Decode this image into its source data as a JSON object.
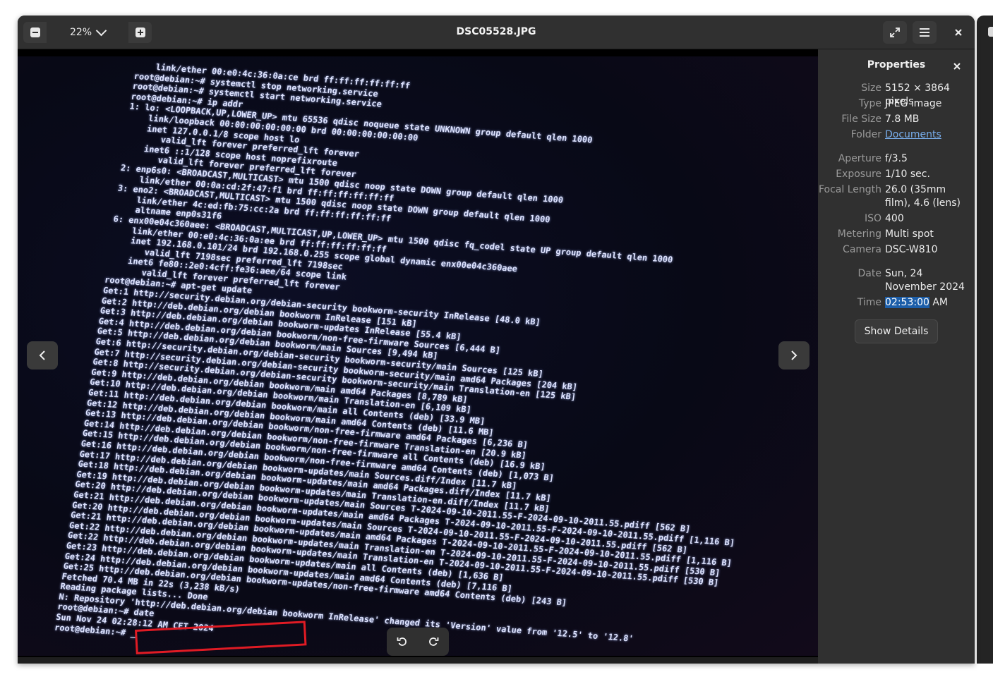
{
  "header": {
    "title": "DSC05528.JPG",
    "zoom": "22%"
  },
  "photo_text": {
    "lines": [
      "    link/ether 00:e0:4c:36:0a:ce brd ff:ff:ff:ff:ff:ff",
      "root@debian:~# systemctl stop networking.service",
      "root@debian:~# systemctl start networking.service",
      "root@debian:~# ip addr",
      "1: lo: <LOOPBACK,UP,LOWER_UP> mtu 65536 qdisc noqueue state UNKNOWN group default qlen 1000",
      "    link/loopback 00:00:00:00:00:00 brd 00:00:00:00:00:00",
      "    inet 127.0.0.1/8 scope host lo",
      "       valid_lft forever preferred_lft forever",
      "    inet6 ::1/128 scope host noprefixroute",
      "       valid_lft forever preferred_lft forever",
      "2: enp6s0: <BROADCAST,MULTICAST> mtu 1500 qdisc noop state DOWN group default qlen 1000",
      "    link/ether 00:0a:cd:2f:47:f1 brd ff:ff:ff:ff:ff:ff",
      "3: eno2: <BROADCAST,MULTICAST> mtu 1500 qdisc noop state DOWN group default qlen 1000",
      "    link/ether 4c:ed:fb:75:cc:2a brd ff:ff:ff:ff:ff:ff",
      "    altname enp0s31f6",
      "6: enx00e04c360aee: <BROADCAST,MULTICAST,UP,LOWER_UP> mtu 1500 qdisc fq_codel state UP group default qlen 1000",
      "    link/ether 00:e0:4c:36:0a:ee brd ff:ff:ff:ff:ff:ff",
      "    inet 192.168.0.101/24 brd 192.168.0.255 scope global dynamic enx00e04c360aee",
      "       valid_lft 7198sec preferred_lft 7198sec",
      "    inet6 fe80::2e0:4cff:fe36:aee/64 scope link",
      "       valid_lft forever preferred_lft forever",
      "root@debian:~# apt-get update",
      "Get:1 http://security.debian.org/debian-security bookworm-security InRelease [48.0 kB]",
      "Get:2 http://deb.debian.org/debian bookworm InRelease [151 kB]",
      "Get:3 http://deb.debian.org/debian bookworm-updates InRelease [55.4 kB]",
      "Get:4 http://deb.debian.org/debian bookworm/non-free-firmware Sources [6,444 B]",
      "Get:5 http://deb.debian.org/debian bookworm/main Sources [9,494 kB]",
      "Get:6 http://security.debian.org/debian-security bookworm-security/main Sources [125 kB]",
      "Get:7 http://security.debian.org/debian-security bookworm-security/main amd64 Packages [204 kB]",
      "Get:8 http://security.debian.org/debian-security bookworm-security/main Translation-en [125 kB]",
      "Get:9 http://deb.debian.org/debian bookworm/main amd64 Packages [8,789 kB]",
      "Get:10 http://deb.debian.org/debian bookworm/main Translation-en [6,109 kB]",
      "Get:11 http://deb.debian.org/debian bookworm/main all Contents (deb) [33.9 MB]",
      "Get:12 http://deb.debian.org/debian bookworm/main amd64 Contents (deb) [11.6 MB]",
      "Get:13 http://deb.debian.org/debian bookworm/non-free-firmware amd64 Packages [6,236 B]",
      "Get:14 http://deb.debian.org/debian bookworm/non-free-firmware Translation-en [20.9 kB]",
      "Get:15 http://deb.debian.org/debian bookworm/non-free-firmware all Contents (deb) [16.9 kB]",
      "Get:16 http://deb.debian.org/debian bookworm/non-free-firmware amd64 Contents (deb) [1,073 B]",
      "Get:17 http://deb.debian.org/debian bookworm-updates/main Sources.diff/Index [11.7 kB]",
      "Get:18 http://deb.debian.org/debian bookworm-updates/main amd64 Packages.diff/Index [11.7 kB]",
      "Get:19 http://deb.debian.org/debian bookworm-updates/main Translation-en.diff/Index [11.7 kB]",
      "Get:20 http://deb.debian.org/debian bookworm-updates/main Sources T-2024-09-10-2011.55-F-2024-09-10-2011.55.pdiff [562 B]",
      "Get:21 http://deb.debian.org/debian bookworm-updates/main amd64 Packages T-2024-09-10-2011.55-F-2024-09-10-2011.55.pdiff [1,116 B]",
      "Get:20 http://deb.debian.org/debian bookworm-updates/main Sources T-2024-09-10-2011.55-F-2024-09-10-2011.55.pdiff [562 B]",
      "Get:21 http://deb.debian.org/debian bookworm-updates/main amd64 Packages T-2024-09-10-2011.55-F-2024-09-10-2011.55.pdiff [1,116 B]",
      "Get:22 http://deb.debian.org/debian bookworm-updates/main Translation-en T-2024-09-10-2011.55-F-2024-09-10-2011.55.pdiff [530 B]",
      "Get:22 http://deb.debian.org/debian bookworm-updates/main Translation-en T-2024-09-10-2011.55-F-2024-09-10-2011.55.pdiff [530 B]",
      "Get:23 http://deb.debian.org/debian bookworm-updates/main all Contents (deb) [1,636 B]",
      "Get:24 http://deb.debian.org/debian bookworm-updates/main amd64 Contents (deb) [7,116 B]",
      "Get:25 http://deb.debian.org/debian bookworm-updates/non-free-firmware amd64 Contents (deb) [243 B]",
      "Fetched 70.4 MB in 22s (3,238 kB/s)",
      "Reading package lists... Done",
      "N: Repository 'http://deb.debian.org/debian bookworm InRelease' changed its 'Version' value from '12.5' to '12.8'",
      "root@debian:~# date",
      "Sun Nov 24 02:28:12 AM CET 2024",
      "root@debian:~# _"
    ]
  },
  "panel": {
    "title": "Properties",
    "size_label": "Size",
    "size_value": "5152 × 3864 pixels",
    "type_label": "Type",
    "type_value": "JPEG image",
    "filesize_label": "File Size",
    "filesize_value": "7.8 MB",
    "folder_label": "Folder",
    "folder_value": "Documents",
    "aperture_label": "Aperture",
    "aperture_value": "f/3.5",
    "exposure_label": "Exposure",
    "exposure_value": "1/10 sec.",
    "focal_label": "Focal Length",
    "focal_value": "26.0 (35mm film), 4.6 (lens)",
    "iso_label": "ISO",
    "iso_value": "400",
    "metering_label": "Metering",
    "metering_value": "Multi spot",
    "camera_label": "Camera",
    "camera_value": "DSC-W810",
    "date_label": "Date",
    "date_value": "Sun, 24 November 2024",
    "time_label": "Time",
    "time_selected": "02:53:00",
    "time_suffix": " AM",
    "details_button": "Show Details"
  },
  "icons": {
    "zoom_out": "zoom-out-icon",
    "zoom_in": "zoom-in-icon",
    "fullscreen": "fullscreen-icon",
    "menu": "hamburger-menu-icon",
    "close": "close-icon",
    "prev": "chevron-left-icon",
    "next": "chevron-right-icon",
    "rotate_left": "rotate-left-icon",
    "rotate_right": "rotate-right-icon"
  },
  "colors": {
    "highlight_box": "#e01b24",
    "link": "#78aeed",
    "selection": "#1c5ea9"
  }
}
